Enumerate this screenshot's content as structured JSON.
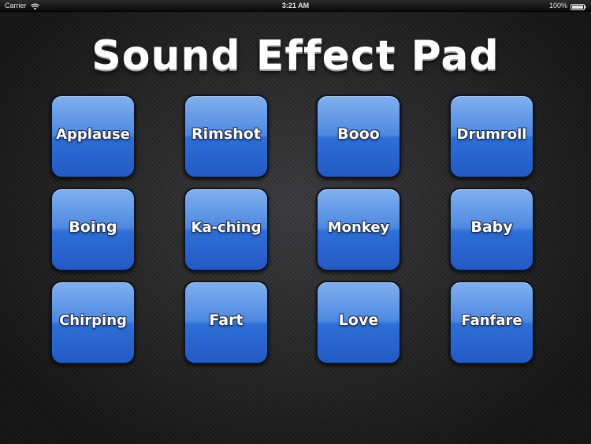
{
  "status_bar": {
    "carrier": "Carrier",
    "wifi_icon": "wifi-icon",
    "time": "3:21 AM",
    "battery_percent": "100%",
    "battery_icon": "battery-icon",
    "battery_level": 1.0
  },
  "app": {
    "title": "Sound Effect Pad",
    "accent_color": "#3a78e0",
    "pads": [
      {
        "label": "Applause"
      },
      {
        "label": "Rimshot"
      },
      {
        "label": "Booo"
      },
      {
        "label": "Drumroll"
      },
      {
        "label": "Boing"
      },
      {
        "label": "Ka-ching"
      },
      {
        "label": "Monkey"
      },
      {
        "label": "Baby"
      },
      {
        "label": "Chirping"
      },
      {
        "label": "Fart"
      },
      {
        "label": "Love"
      },
      {
        "label": "Fanfare"
      }
    ]
  }
}
